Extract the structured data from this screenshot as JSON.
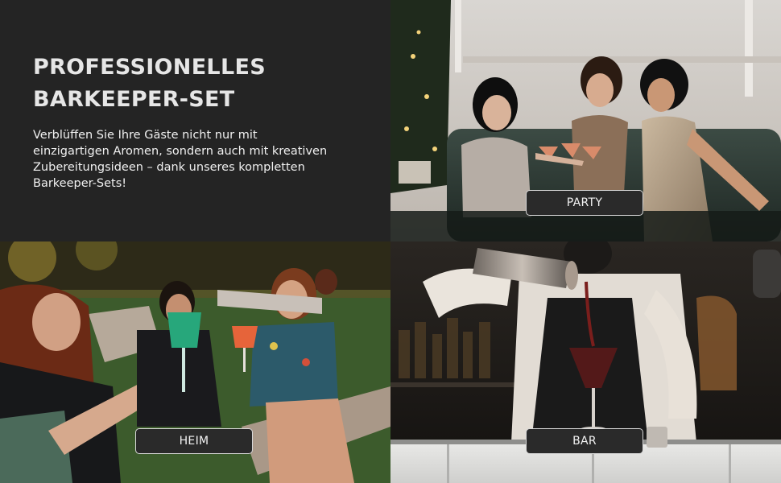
{
  "hero": {
    "title_line1": "PROFESSIONELLES",
    "title_line2": "BARKEEPER-SET",
    "description_lines": [
      "Verblüffen Sie Ihre Gäste nicht nur mit",
      "einzigartigen Aromen, sondern auch mit kreativen",
      "Zubereitungsideen – dank unseres kompletten",
      "Barkeeper-Sets!"
    ]
  },
  "tiles": {
    "party": {
      "label": "PARTY"
    },
    "heim": {
      "label": "HEIM"
    },
    "bar": {
      "label": "BAR"
    }
  }
}
